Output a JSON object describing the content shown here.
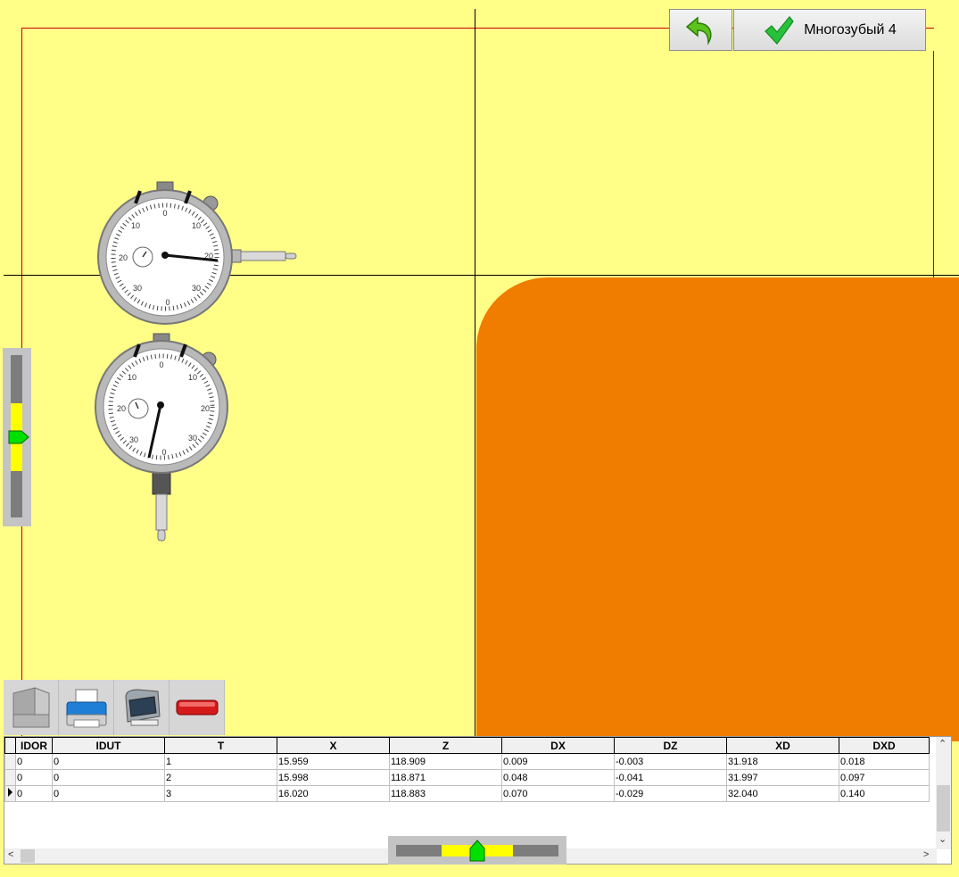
{
  "toolbar_top": {
    "back_icon": "undo-arrow-icon",
    "ok_icon": "checkmark-icon",
    "ok_label": "Многозубый 4"
  },
  "colors": {
    "background": "#ffff88",
    "part": "#f07c00",
    "frame": "#cc0000",
    "slider_marker": "#00e000",
    "slider_zone": "#ffff00"
  },
  "gauges": {
    "top": {
      "tick_labels": [
        "0",
        "10",
        "20",
        "30",
        "30",
        "20",
        "10",
        "0"
      ]
    },
    "bottom": {
      "tick_labels": [
        "0",
        "10",
        "20",
        "30",
        "30",
        "20",
        "10",
        "0"
      ]
    }
  },
  "bottom_toolbar": {
    "items": [
      {
        "icon": "part-view-icon"
      },
      {
        "icon": "printer-icon"
      },
      {
        "icon": "label-printer-icon"
      },
      {
        "icon": "red-bar-icon"
      }
    ]
  },
  "grid": {
    "columns": [
      "IDOR",
      "IDUT",
      "T",
      "X",
      "Z",
      "DX",
      "DZ",
      "XD",
      "DXD"
    ],
    "rows": [
      [
        "0",
        "0",
        "1",
        "15.959",
        "118.909",
        "0.009",
        "-0.003",
        "31.918",
        "0.018"
      ],
      [
        "0",
        "0",
        "2",
        "15.998",
        "118.871",
        "0.048",
        "-0.041",
        "31.997",
        "0.097"
      ],
      [
        "0",
        "0",
        "3",
        "16.020",
        "118.883",
        "0.070",
        "-0.029",
        "32.040",
        "0.140"
      ]
    ],
    "current_row": 2
  },
  "sliders": {
    "vertical_level": 0.5,
    "horizontal_level": 0.5
  }
}
